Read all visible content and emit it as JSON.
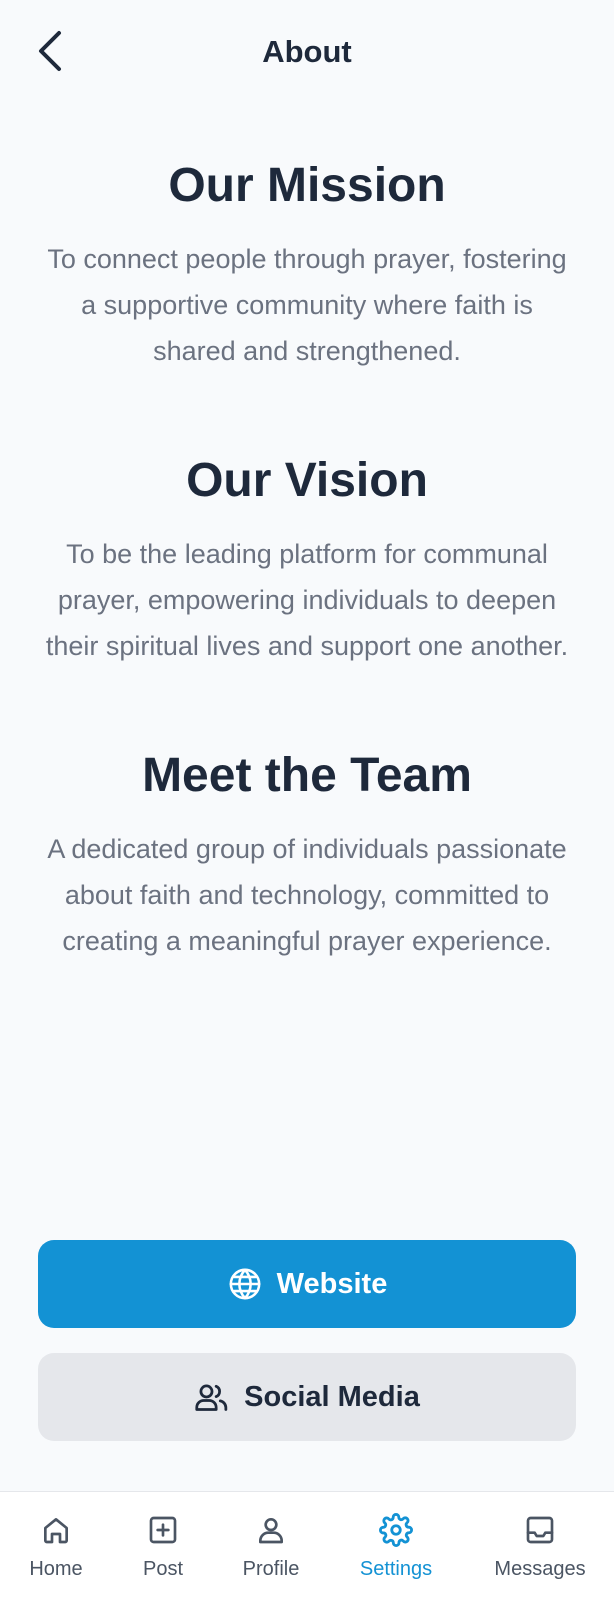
{
  "header": {
    "title": "About",
    "back_icon": "chevron-left-icon"
  },
  "sections": [
    {
      "heading": "Our Mission",
      "body": "To connect people through prayer, fostering a supportive community where faith is shared and strengthened."
    },
    {
      "heading": "Our Vision",
      "body": "To be the leading platform for communal prayer, empowering individuals to deepen their spiritual lives and support one another."
    },
    {
      "heading": "Meet the Team",
      "body": "A dedicated group of individuals passionate about faith and technology, committed to creating a meaningful prayer experience."
    }
  ],
  "buttons": {
    "website": {
      "label": "Website",
      "icon": "globe-icon"
    },
    "social": {
      "label": "Social Media",
      "icon": "users-icon"
    }
  },
  "tabbar": {
    "active": "settings",
    "tabs": [
      {
        "id": "home",
        "label": "Home",
        "icon": "home-icon"
      },
      {
        "id": "post",
        "label": "Post",
        "icon": "plus-square-icon"
      },
      {
        "id": "profile",
        "label": "Profile",
        "icon": "user-icon"
      },
      {
        "id": "settings",
        "label": "Settings",
        "icon": "gear-icon"
      },
      {
        "id": "messages",
        "label": "Messages",
        "icon": "inbox-icon"
      }
    ]
  },
  "colors": {
    "accent": "#1392d4",
    "background": "#f8fafc",
    "text_primary": "#1e293b",
    "text_secondary": "#6b7280",
    "secondary_button": "#e5e7eb"
  }
}
